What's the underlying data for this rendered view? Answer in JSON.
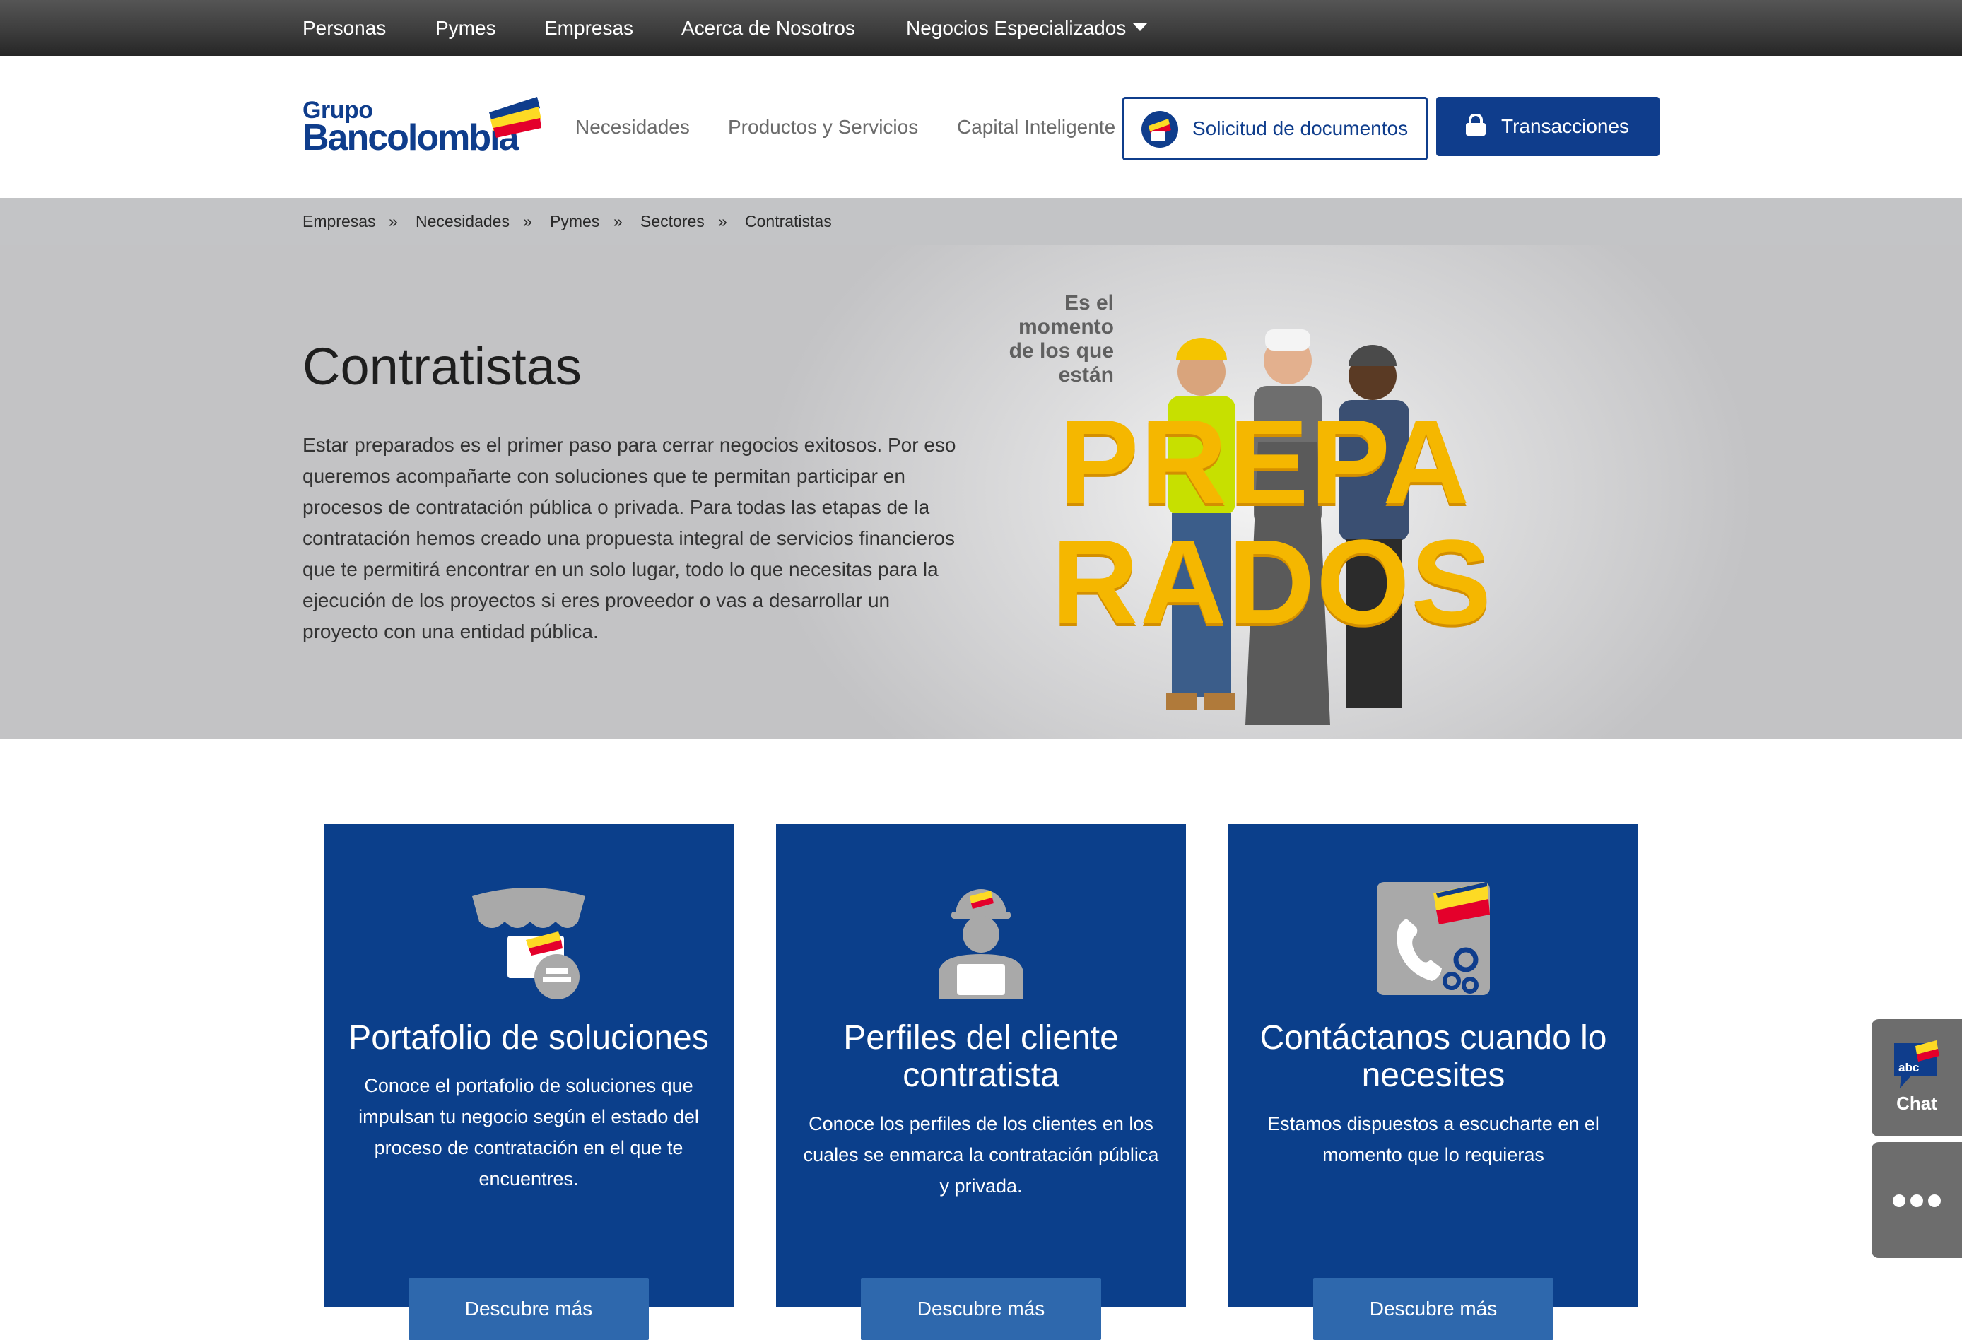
{
  "topnav": {
    "items": [
      "Personas",
      "Pymes",
      "Empresas",
      "Acerca de Nosotros",
      "Negocios Especializados"
    ]
  },
  "header": {
    "logo_line1": "Grupo",
    "logo_line2": "Bancolombia",
    "nav": [
      "Necesidades",
      "Productos y Servicios",
      "Capital Inteligente"
    ],
    "docs_button": "Solicitud de documentos",
    "trans_button": "Transacciones"
  },
  "breadcrumb": [
    "Empresas",
    "Necesidades",
    "Pymes",
    "Sectores",
    "Contratistas"
  ],
  "breadcrumb_sep": "»",
  "hero": {
    "title": "Contratistas",
    "body": "Estar preparados es el primer paso para cerrar negocios exitosos. Por eso queremos acompañarte con soluciones que te permitan participar en procesos de contratación pública o privada. Para todas las etapas de la contratación hemos creado una propuesta integral de servicios financieros que te permitirá encontrar en un solo lugar, todo lo que necesitas para la ejecución de los proyectos si eres proveedor o vas a desarrollar un proyecto con una entidad pública.",
    "tag_lines": [
      "Es el",
      "momento",
      "de los que",
      "están"
    ],
    "big_line1": "PREPA",
    "big_line2": "RADOS"
  },
  "cards": [
    {
      "title": "Portafolio de soluciones",
      "text": "Conoce el portafolio de soluciones que impulsan tu negocio según el estado del proceso de contratación en el que te encuentres.",
      "cta": "Descubre más",
      "icon": "storefront-icon"
    },
    {
      "title": "Perfiles del cliente contratista",
      "text": "Conoce los perfiles de los clientes en los cuales se enmarca la contratación pública y privada.",
      "cta": "Descubre más",
      "icon": "worker-icon"
    },
    {
      "title": "Contáctanos cuando lo necesites",
      "text": "Estamos dispuestos a escucharte en el momento que lo requieras",
      "cta": "Descubre más",
      "icon": "phone-gears-icon"
    }
  ],
  "side": {
    "chat_label": "Chat",
    "chat_badge": "abc"
  },
  "colors": {
    "brand_blue": "#0f3d8c",
    "card_blue": "#0b3f8b",
    "cta_blue": "#2e68ad",
    "brand_yellow": "#fdda24",
    "brand_red": "#e4002b",
    "prepared_yellow": "#f5b700"
  }
}
